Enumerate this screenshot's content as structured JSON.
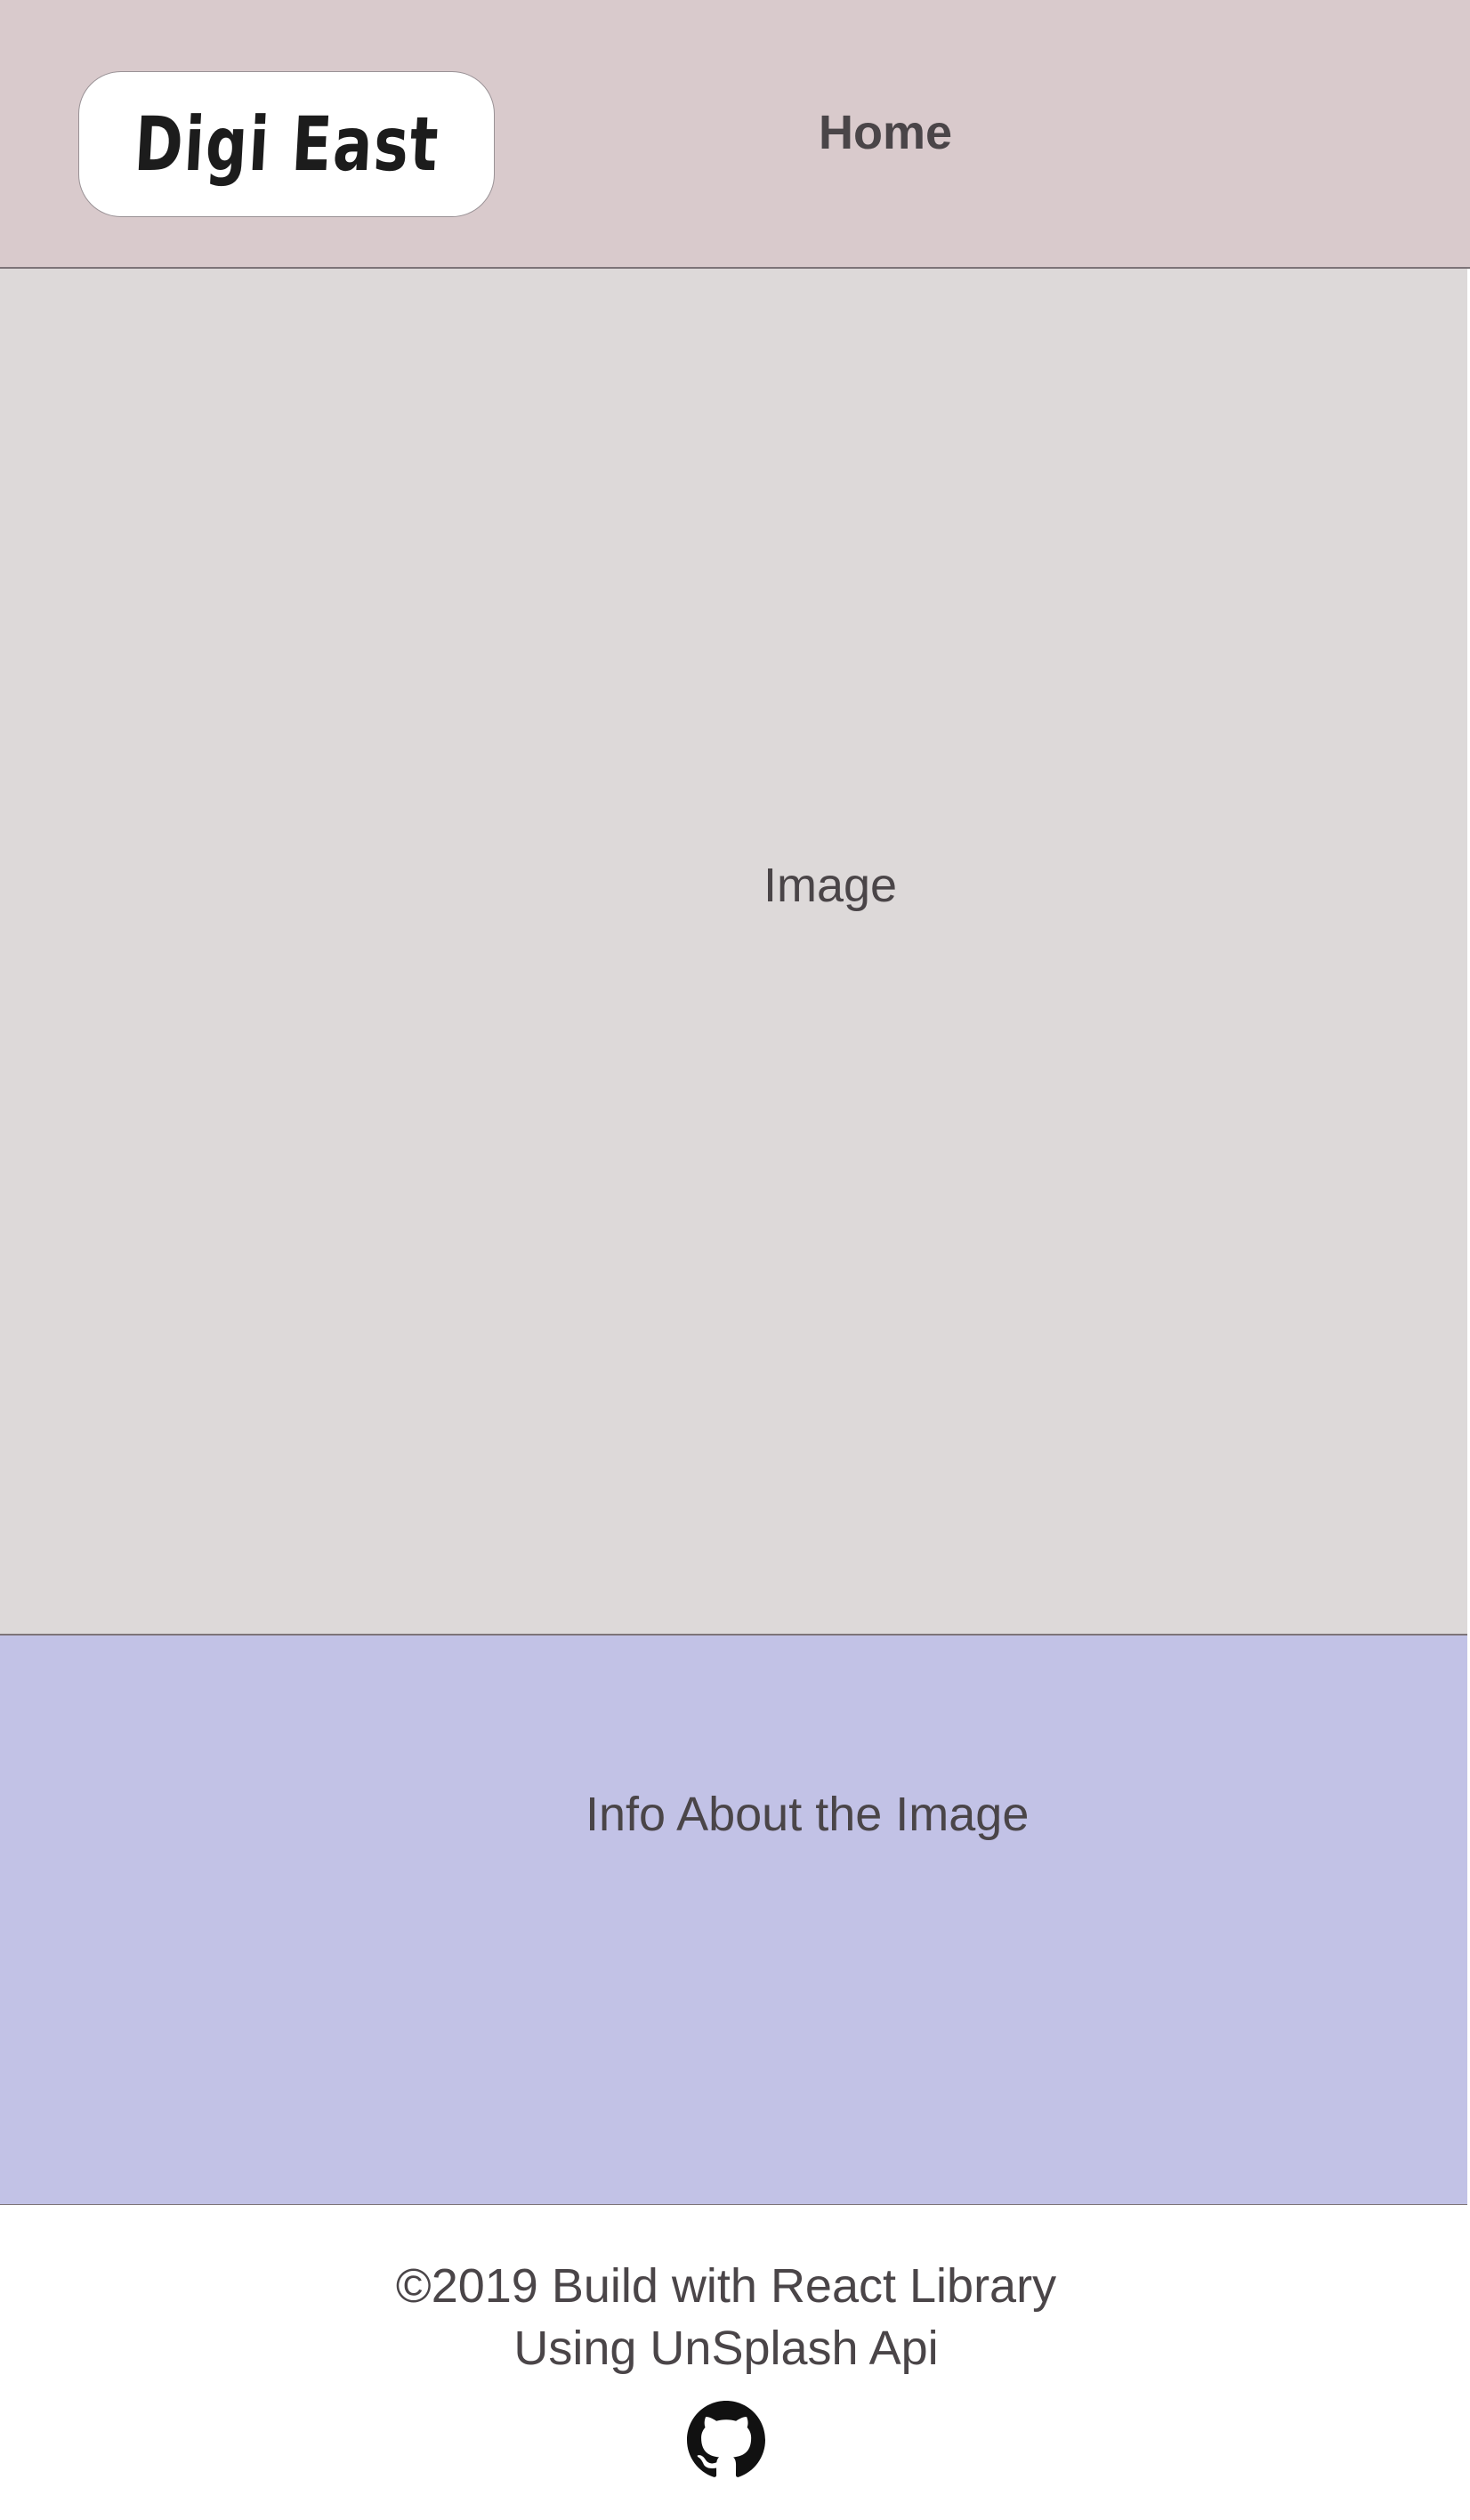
{
  "header": {
    "logo_text": "Digi East",
    "nav_home": "Home"
  },
  "main": {
    "image_placeholder": "Image",
    "info_placeholder": "Info About the Image"
  },
  "footer": {
    "copyright": "©2019 Build with React Library",
    "credit": "Using UnSplash Api",
    "github_icon": "github-icon"
  },
  "colors": {
    "header_bg": "#d9cacc",
    "image_bg": "#ddd9d9",
    "info_bg": "#c2c2e6",
    "text": "#4a4548"
  }
}
